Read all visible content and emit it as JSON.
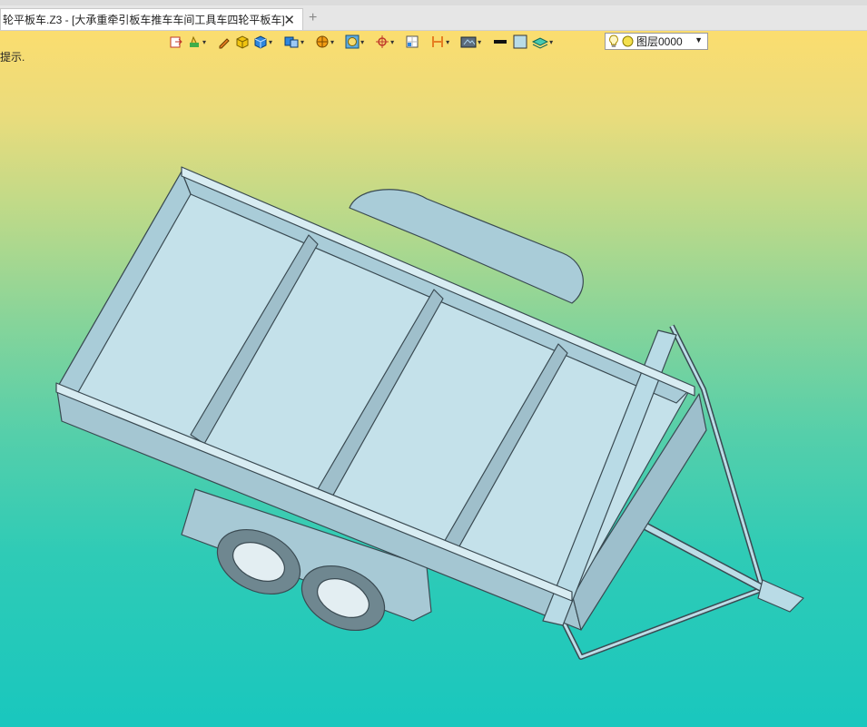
{
  "tab": {
    "title": "轮平板车.Z3 - [大承重牵引板车推车车间工具车四轮平板车]",
    "close_label": "✕",
    "new_label": "+"
  },
  "viewport": {
    "hint": "提示.",
    "gradient_top": "#fbdd6f",
    "gradient_bottom": "#19c7be"
  },
  "toolbar": {
    "icons": [
      "exit-sketch-icon",
      "paint-icon",
      "pen-icon",
      "box-shaded-icon",
      "cube-icon",
      "view-cube-icon",
      "render-icon",
      "circle-frame-icon",
      "axis-icon",
      "grid-icon",
      "dimension-icon",
      "display-mode-icon",
      "line-color-icon",
      "fill-color-icon",
      "layer-stack-icon"
    ],
    "layer_label": "图层0000"
  },
  "colors": {
    "model_fill": "#b9dbe6",
    "model_edge": "#3a4a52",
    "accent": "#1e6fd0"
  }
}
